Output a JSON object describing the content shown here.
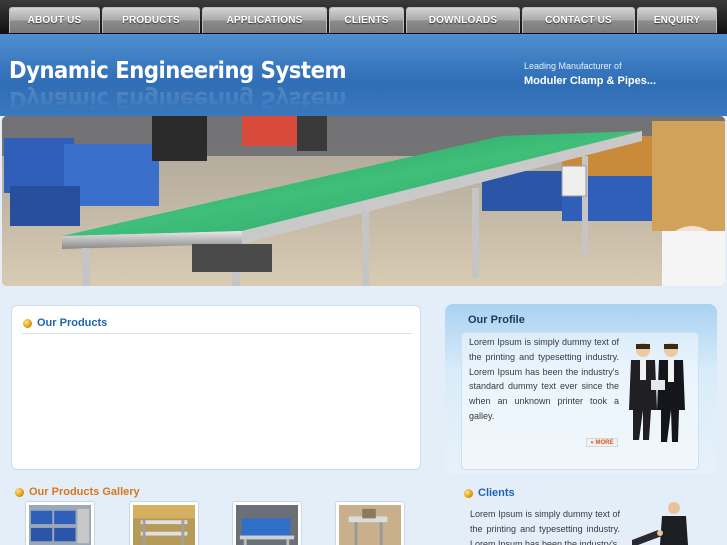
{
  "nav": {
    "items": [
      {
        "label": "ABOUT US"
      },
      {
        "label": "PRODUCTS"
      },
      {
        "label": "APPLICATIONS"
      },
      {
        "label": "CLIENTS"
      },
      {
        "label": "DOWNLOADS"
      },
      {
        "label": "CONTACT US"
      },
      {
        "label": "ENQUIRY"
      }
    ]
  },
  "header": {
    "brand": "Dynamic Engineering System",
    "tagline_small": "Leading Manufacturer of",
    "tagline_bold": "Moduler Clamp & Pipes..."
  },
  "products": {
    "title": "Our Products"
  },
  "profile": {
    "title": "Our Profile",
    "text": "Lorem Ipsum is simply dummy text of the printing and typesetting industry. Lorem Ipsum has been the industry's standard dummy text ever since the when an unknown printer took a galley.",
    "more_label": "» MORE"
  },
  "gallery": {
    "title": "Our Products Gallery"
  },
  "clients": {
    "title": "Clients",
    "text": "Lorem Ipsum is simply dummy text of the printing and typesetting industry. Lorem Ipsum has been the industry's"
  },
  "colors": {
    "nav_bg": "#1a1a1a",
    "header_blue": "#2f6db5",
    "section_blue": "#1e63b4",
    "gallery_orange": "#d9761a"
  }
}
